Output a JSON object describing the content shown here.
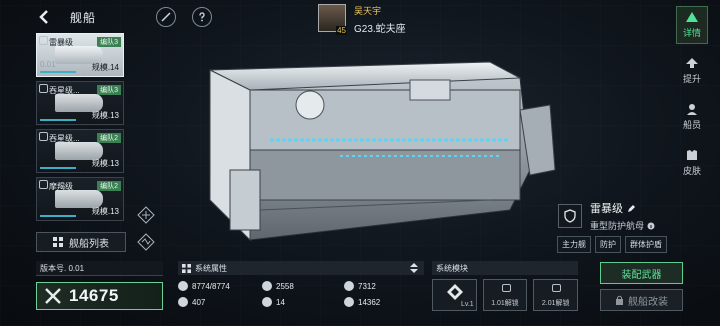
{
  "header": {
    "title": "舰船"
  },
  "player": {
    "name": "吴天宇",
    "location": "G23.蛇夫座",
    "level": "45"
  },
  "nav": [
    {
      "label": "详情",
      "icon": "details-icon",
      "active": true
    },
    {
      "label": "提升",
      "icon": "upgrade-icon",
      "active": false
    },
    {
      "label": "船员",
      "icon": "crew-icon",
      "active": false
    },
    {
      "label": "皮肤",
      "icon": "skin-icon",
      "active": false
    }
  ],
  "ships": [
    {
      "name": "雷暴级",
      "fleet": "编队3",
      "level": "0.01",
      "scale": "规模.14",
      "selected": true
    },
    {
      "name": "吞星级...",
      "fleet": "编队3",
      "level": "",
      "scale": "规模.13",
      "selected": false
    },
    {
      "name": "吞星级...",
      "fleet": "编队2",
      "level": "",
      "scale": "规模.13",
      "selected": false
    },
    {
      "name": "摩羯级",
      "fleet": "编队2",
      "level": "",
      "scale": "规模.13",
      "selected": false
    }
  ],
  "fleet_list_label": "舰船列表",
  "ship_info": {
    "class_name": "雷暴级",
    "role": "重型防护航母",
    "tags": [
      "主力舰",
      "防护",
      "群体护盾"
    ]
  },
  "version": "版本号. 0.01",
  "power": "14675",
  "attributes": {
    "header": "系统属性",
    "items": [
      {
        "icon": "shield-stat-icon",
        "value": "8774/8774"
      },
      {
        "icon": "armor-stat-icon",
        "value": "2558"
      },
      {
        "icon": "energy-stat-icon",
        "value": "7312"
      },
      {
        "icon": "speed-stat-icon",
        "value": "407"
      },
      {
        "icon": "crew-stat-icon",
        "value": "14"
      },
      {
        "icon": "cargo-stat-icon",
        "value": "14362"
      }
    ]
  },
  "modules": {
    "header": "系统模块",
    "slots": [
      {
        "label": "Lv.1",
        "locked": false
      },
      {
        "label": "1.01解锁",
        "locked": true
      },
      {
        "label": "2.01解锁",
        "locked": true
      }
    ]
  },
  "buttons": {
    "equip": "装配武器",
    "refit": "舰船改装"
  }
}
